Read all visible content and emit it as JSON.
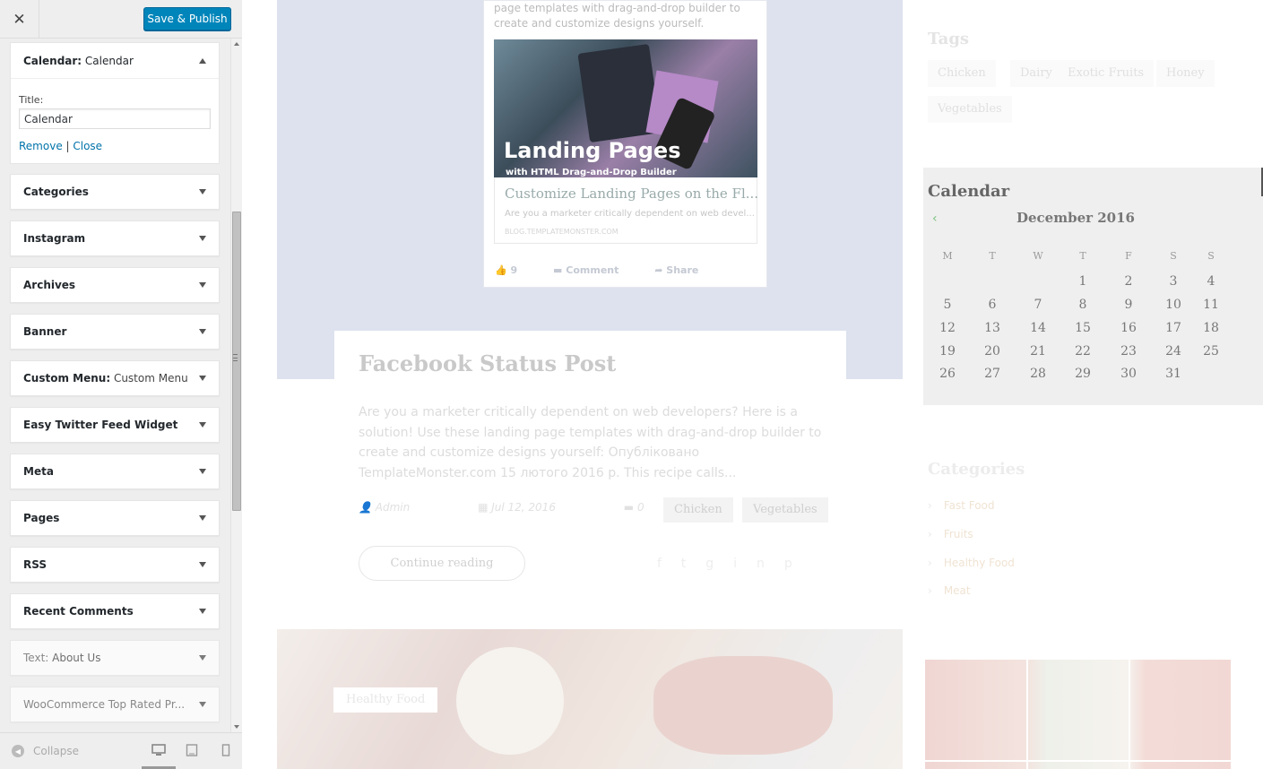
{
  "sidebar": {
    "close_icon": "close-icon",
    "publish_label": "Save & Publish",
    "open_widget": {
      "title_bold": "Calendar:",
      "title_sub": " Calendar",
      "field_label": "Title:",
      "field_value": "Calendar",
      "remove_label": "Remove",
      "separator": " | ",
      "close_label": "Close"
    },
    "widgets": [
      {
        "label": "Categories",
        "sub": ""
      },
      {
        "label": "Instagram",
        "sub": ""
      },
      {
        "label": "Archives",
        "sub": ""
      },
      {
        "label": "Banner",
        "sub": ""
      },
      {
        "label": "Custom Menu:",
        "sub": " Custom Menu"
      },
      {
        "label": "Easy Twitter Feed Widget",
        "sub": ""
      },
      {
        "label": "Meta",
        "sub": ""
      },
      {
        "label": "Pages",
        "sub": ""
      },
      {
        "label": "RSS",
        "sub": ""
      },
      {
        "label": "Recent Comments",
        "sub": ""
      },
      {
        "label": "Text:",
        "sub": " About Us"
      },
      {
        "label": "WooCommerce Top Rated Pr...",
        "sub": ""
      }
    ],
    "footer": {
      "collapse_label": "Collapse",
      "devices": [
        "desktop-icon",
        "tablet-icon",
        "mobile-icon"
      ]
    }
  },
  "preview": {
    "fb_text": "page templates with drag-and-drop builder to create and customize designs yourself.",
    "fb_image_big": "Landing Pages",
    "fb_image_small": "with HTML Drag-and-Drop Builder",
    "fb_link_title": "Customize Landing Pages on the Fl...",
    "fb_link_desc": "Are you a marketer critically dependent on web devel...",
    "fb_link_domain": "BLOG.TEMPLATEMONSTER.COM",
    "fb_likes": "9",
    "fb_comment": "Comment",
    "fb_share": "Share",
    "post_title": "Facebook Status Post",
    "post_excerpt": "Are you a marketer critically dependent on web developers? Here is a solution! Use these landing page templates with drag-and-drop builder to create and customize designs yourself: Опубліковано TemplateMonster.com 15 лютого 2016 р. This recipe calls...",
    "post_author": "Admin",
    "post_date": "Jul 12, 2016",
    "post_comments": "0",
    "post_tags": [
      "Chicken",
      "Vegetables"
    ],
    "continue_label": "Continue reading",
    "food_tag": "Healthy Food",
    "tags_heading": "Tags",
    "tag_cloud": [
      "Chicken",
      "Dairy",
      "Exotic Fruits",
      "Honey",
      "Vegetables"
    ],
    "calendar": {
      "heading": "Calendar",
      "month": "December 2016",
      "prev": "‹",
      "weekdays": [
        "M",
        "T",
        "W",
        "T",
        "F",
        "S",
        "S"
      ],
      "weeks": [
        [
          "",
          "",
          "",
          "1",
          "2",
          "3",
          "4"
        ],
        [
          "5",
          "6",
          "7",
          "8",
          "9",
          "10",
          "11"
        ],
        [
          "12",
          "13",
          "14",
          "15",
          "16",
          "17",
          "18"
        ],
        [
          "19",
          "20",
          "21",
          "22",
          "23",
          "24",
          "25"
        ],
        [
          "26",
          "27",
          "28",
          "29",
          "30",
          "31",
          ""
        ]
      ]
    },
    "cats_heading": "Categories",
    "categories": [
      "Fast Food",
      "Fruits",
      "Healthy Food",
      "Meat"
    ]
  }
}
